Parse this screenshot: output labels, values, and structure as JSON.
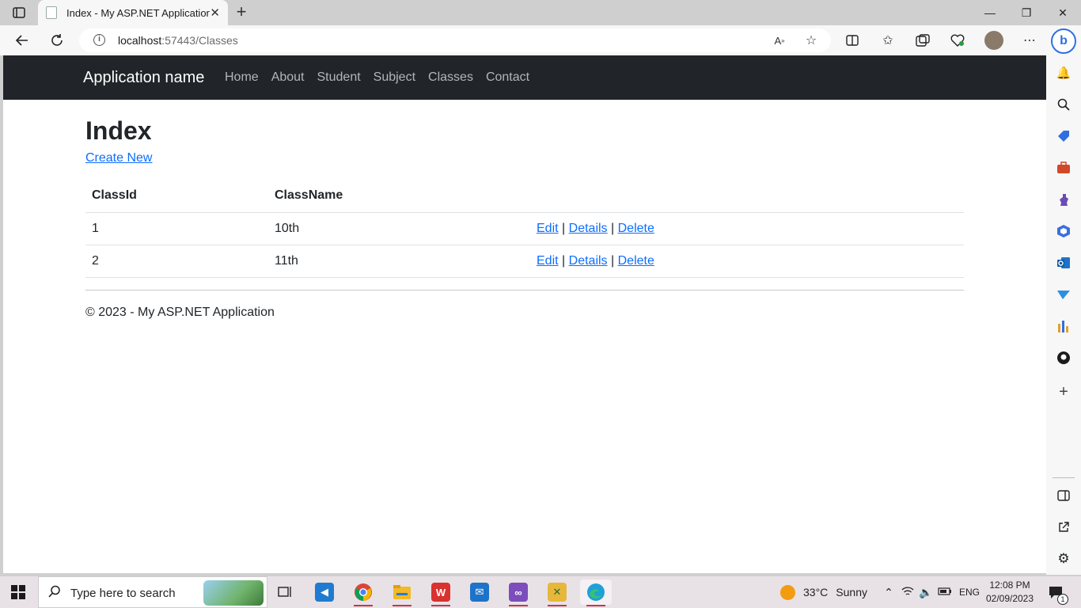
{
  "browser": {
    "tab_title": "Index - My ASP.NET Application",
    "new_tab": "+",
    "url_host": "localhost",
    "url_path": ":57443/Classes",
    "window_controls": {
      "minimize": "—",
      "maximize": "❐",
      "close": "✕"
    }
  },
  "site": {
    "brand": "Application name",
    "nav": [
      "Home",
      "About",
      "Student",
      "Subject",
      "Classes",
      "Contact"
    ],
    "heading": "Index",
    "create_new": "Create New",
    "table": {
      "headers": [
        "ClassId",
        "ClassName",
        ""
      ],
      "rows": [
        {
          "id": "1",
          "name": "10th"
        },
        {
          "id": "2",
          "name": "11th"
        }
      ],
      "actions": {
        "edit": "Edit",
        "details": "Details",
        "delete": "Delete",
        "separator": "|"
      }
    },
    "footer": "© 2023 - My ASP.NET Application"
  },
  "taskbar": {
    "search_placeholder": "Type here to search",
    "weather_temp": "33°C",
    "weather_text": "Sunny",
    "language": "ENG",
    "time": "12:08 PM",
    "date": "02/09/2023",
    "notification_count": "1"
  },
  "colors": {
    "navbar_bg": "#212529",
    "link": "#0d6efd",
    "edge_accent": "#2f6fe0"
  }
}
